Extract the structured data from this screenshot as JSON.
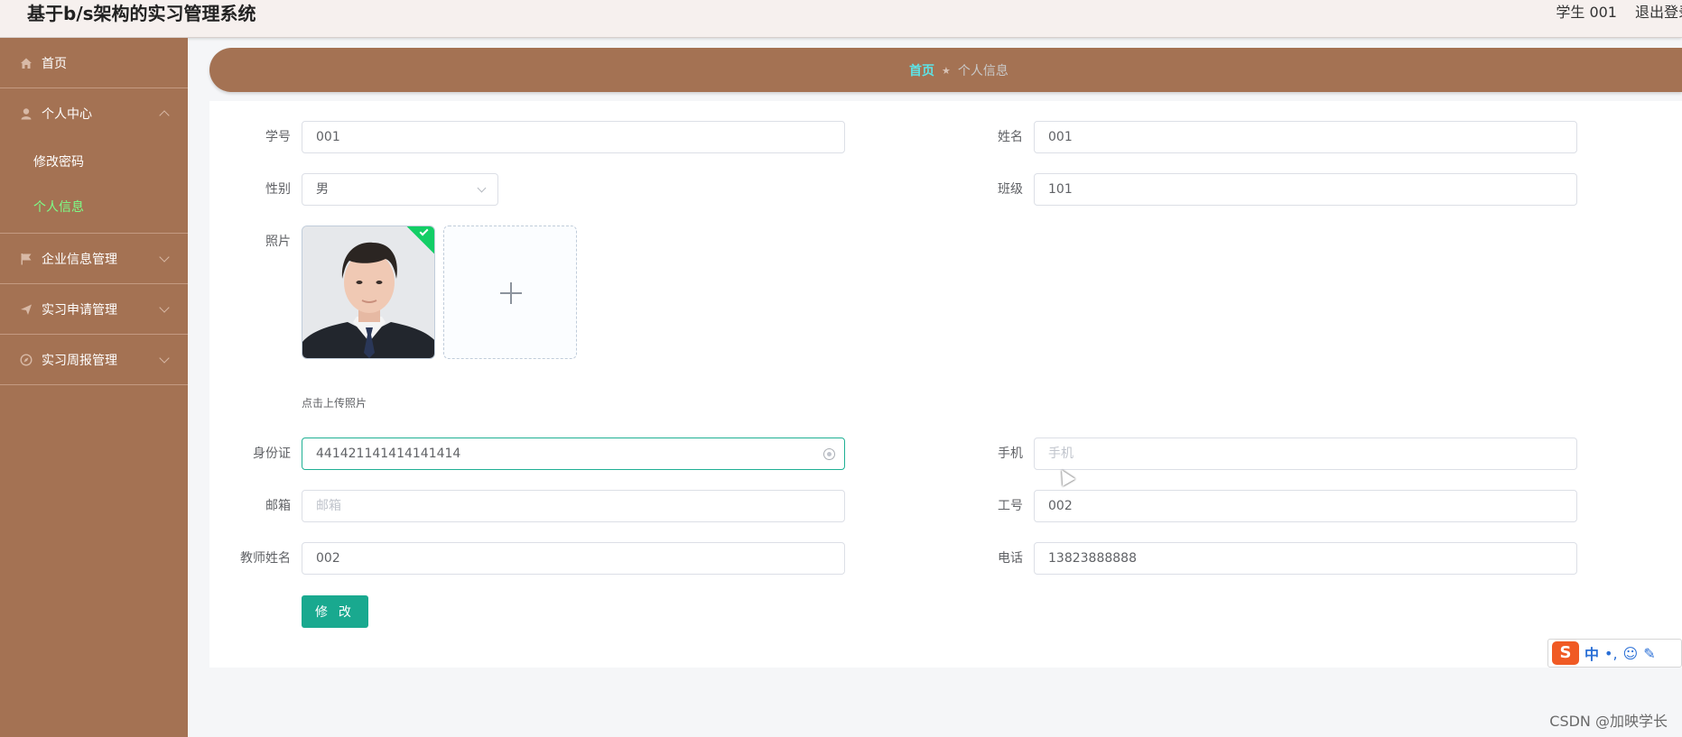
{
  "header": {
    "title": "基于b/s架构的实习管理系统",
    "user": "学生 001",
    "logout": "退出登录"
  },
  "sidebar": {
    "items": [
      {
        "label": "首页",
        "icon": "home-icon"
      },
      {
        "label": "个人中心",
        "icon": "user-icon",
        "expanded": true,
        "children": [
          {
            "label": "修改密码"
          },
          {
            "label": "个人信息",
            "active": true
          }
        ]
      },
      {
        "label": "企业信息管理",
        "icon": "flag-icon"
      },
      {
        "label": "实习申请管理",
        "icon": "send-icon"
      },
      {
        "label": "实习周报管理",
        "icon": "compass-icon"
      }
    ]
  },
  "breadcrumb": {
    "home": "首页",
    "separator": "★",
    "current": "个人信息"
  },
  "form": {
    "student_id": {
      "label": "学号",
      "value": "001"
    },
    "name": {
      "label": "姓名",
      "value": "001"
    },
    "gender": {
      "label": "性别",
      "value": "男"
    },
    "class": {
      "label": "班级",
      "value": "101"
    },
    "photo": {
      "label": "照片",
      "tip": "点击上传照片"
    },
    "id_card": {
      "label": "身份证",
      "value": "441421141414141414"
    },
    "mobile": {
      "label": "手机",
      "value": "",
      "placeholder": "手机"
    },
    "email": {
      "label": "邮箱",
      "value": "",
      "placeholder": "邮箱"
    },
    "staff_no": {
      "label": "工号",
      "value": "002"
    },
    "teacher_name": {
      "label": "教师姓名",
      "value": "002"
    },
    "phone": {
      "label": "电话",
      "value": "13823888888"
    },
    "submit_label": "修 改"
  },
  "ime": {
    "logo": "S",
    "mode": "中",
    "punct": "•,",
    "emoji": "☺",
    "pen": "✎"
  },
  "watermark": "CSDN @加映学长",
  "colors": {
    "sidebar": "#a47253",
    "accent": "#19a98f",
    "active_menu": "#7cff87"
  }
}
